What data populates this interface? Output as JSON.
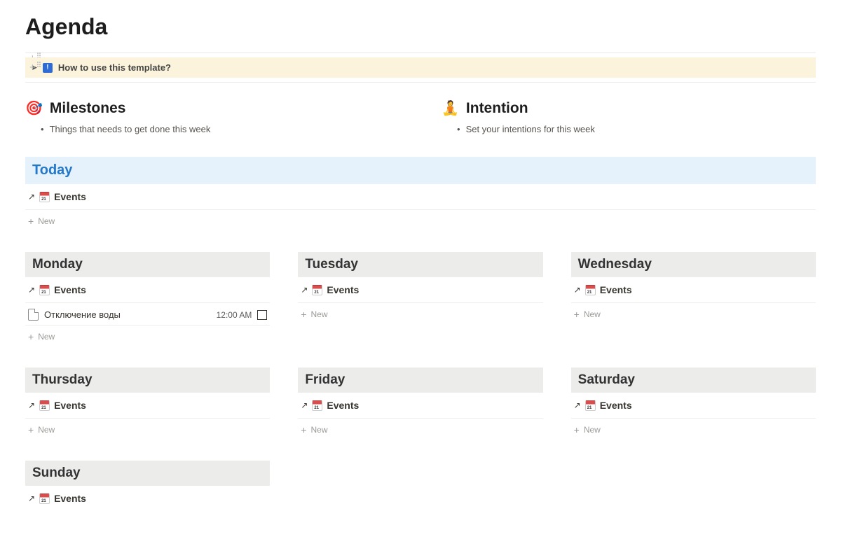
{
  "pageTitle": "Agenda",
  "toggle": {
    "iconGlyph": "!",
    "text": "How to use this template?"
  },
  "milestones": {
    "emoji": "🎯",
    "heading": "Milestones",
    "bullet": "Things that needs to get done this week"
  },
  "intention": {
    "emoji": "🧘",
    "heading": "Intention",
    "bullet": "Set your intentions for this week"
  },
  "today": {
    "heading": "Today",
    "eventsLabel": "Events",
    "newLabel": "New"
  },
  "mondayItem": {
    "title": "Отключение воды",
    "time": "12:00 AM"
  },
  "labels": {
    "events": "Events",
    "new": "New"
  },
  "days": {
    "mon": "Monday",
    "tue": "Tuesday",
    "wed": "Wednesday",
    "thu": "Thursday",
    "fri": "Friday",
    "sat": "Saturday",
    "sun": "Sunday"
  }
}
